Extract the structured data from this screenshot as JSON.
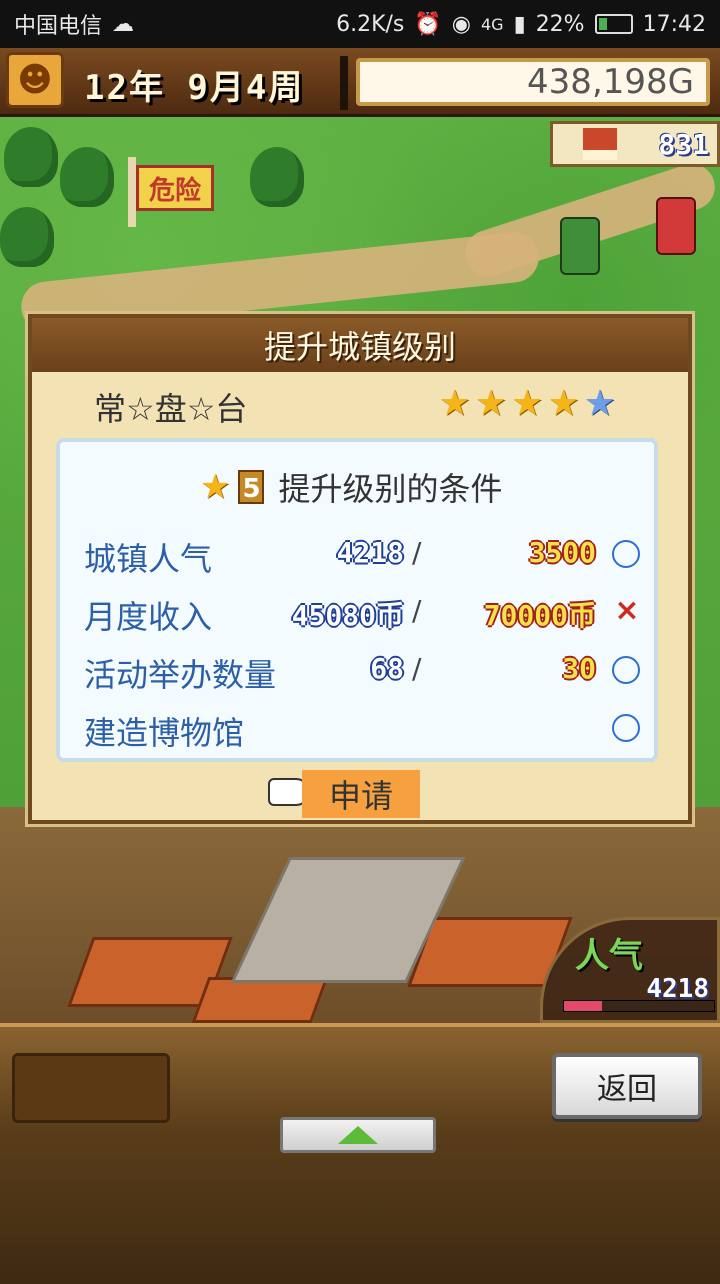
{
  "status_bar": {
    "carrier": "中国电信",
    "net_speed": "6.2K/s",
    "signal": "4G",
    "battery": "22%",
    "time": "17:42"
  },
  "hud": {
    "date": "12年 9月4周",
    "gold": "438,198G",
    "population": "831",
    "danger_sign": "危险"
  },
  "dialog": {
    "title": "提升城镇级别",
    "town_name": "常☆盘☆台",
    "stars_filled": 4,
    "stars_total": 5,
    "condition_header": {
      "level": "5",
      "title": "提升级别的条件"
    },
    "conditions": [
      {
        "label": "城镇人气",
        "current": "4218",
        "slash": "/",
        "required": "3500",
        "met": true,
        "mark": ""
      },
      {
        "label": "月度收入",
        "current": "45080币",
        "slash": "/",
        "required": "70000币",
        "met": false,
        "mark": "×"
      },
      {
        "label": "活动举办数量",
        "current": "68",
        "slash": "/",
        "required": "30",
        "met": true,
        "mark": ""
      },
      {
        "label": "建造博物馆",
        "current": "",
        "slash": "",
        "required": "",
        "met": true,
        "mark": ""
      }
    ],
    "apply_label": "申请"
  },
  "popularity_meter": {
    "label": "人气",
    "value": "4218",
    "fill": 0.25
  },
  "bottom_bar": {
    "back_label": "返回"
  },
  "colors": {
    "accent_gold": "#f4b41a",
    "condition_label": "#2c5fa8",
    "unmet_mark": "#d02a1a",
    "apply_button": "#f7a040"
  }
}
